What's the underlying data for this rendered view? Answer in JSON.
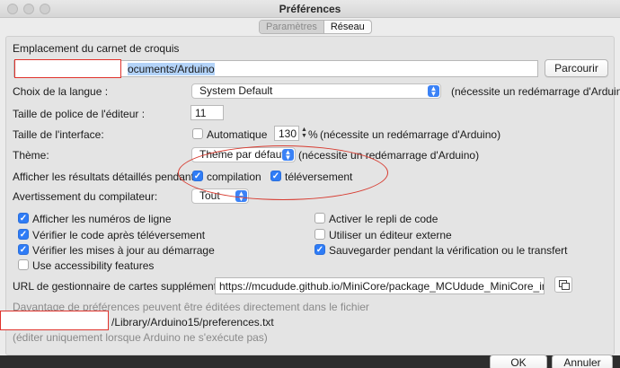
{
  "window": {
    "title": "Préférences"
  },
  "tabs": [
    {
      "label": "Paramètres",
      "active": true
    },
    {
      "label": "Réseau",
      "active": false
    }
  ],
  "sketchbook": {
    "label": "Emplacement du carnet de croquis",
    "path_visible": "ocuments/Arduino",
    "browse_button": "Parcourir"
  },
  "language": {
    "label": "Choix de la langue :",
    "value": "System Default",
    "note": "(nécessite un redémarrage d'Arduino)"
  },
  "editor_font": {
    "label": "Taille de police de l'éditeur :",
    "value": "11"
  },
  "interface_size": {
    "label": "Taille de l'interface:",
    "auto_label": "Automatique",
    "auto_checked": false,
    "value": "130",
    "unit": "%",
    "note": "(nécessite un redémarrage d'Arduino)"
  },
  "theme": {
    "label": "Thème:",
    "value": "Thème par défaut",
    "note": "(nécessite un redémarrage d'Arduino)"
  },
  "verbose": {
    "label": "Afficher les résultats détaillés pendant :",
    "compile_label": "compilation",
    "compile_checked": true,
    "upload_label": "téléversement",
    "upload_checked": true
  },
  "compiler_warnings": {
    "label": "Avertissement du compilateur:",
    "value": "Tout"
  },
  "options_left": [
    {
      "label": "Afficher les numéros de ligne",
      "checked": true
    },
    {
      "label": "Vérifier le code après téléversement",
      "checked": true
    },
    {
      "label": "Vérifier les mises à jour au démarrage",
      "checked": true
    },
    {
      "label": "Use accessibility features",
      "checked": false
    }
  ],
  "options_right": [
    {
      "label": "Activer le repli de code",
      "checked": false
    },
    {
      "label": "Utiliser un éditeur externe",
      "checked": false
    },
    {
      "label": "Sauvegarder pendant la vérification ou le transfert",
      "checked": true
    }
  ],
  "boards_url": {
    "label": "URL de gestionnaire de cartes supplémentaires",
    "value": "https://mcudude.github.io/MiniCore/package_MCUdude_MiniCore_index.json"
  },
  "prefs_file": {
    "info": "Davantage de préférences peuvent être éditées directement dans le fichier",
    "path_visible": "/Library/Arduino15/preferences.txt",
    "note": "(éditer uniquement lorsque Arduino ne s'exécute pas)"
  },
  "footer": {
    "ok_label": "OK",
    "cancel_label": "Annuler"
  },
  "icons": {
    "copy": "copy-icon",
    "dropdown": "chevron-updown-icon"
  },
  "colors": {
    "accent": "#2f7cf6",
    "annotation_red": "#e0332c"
  }
}
